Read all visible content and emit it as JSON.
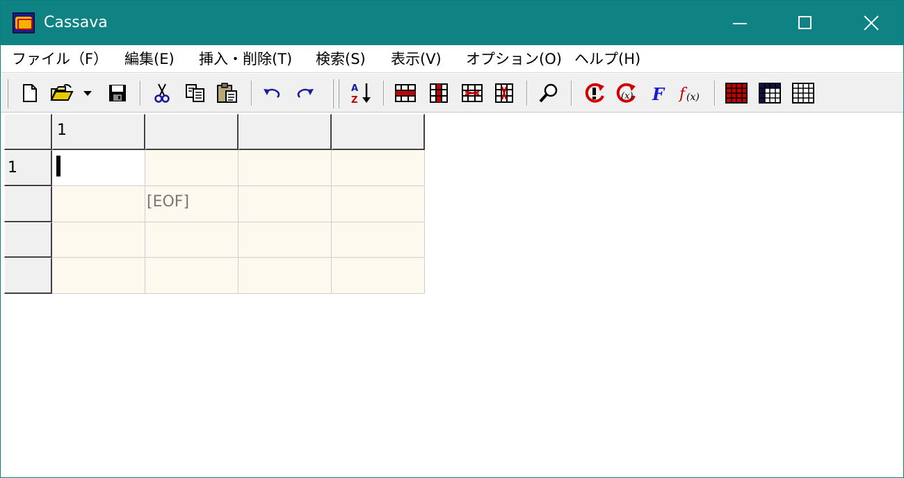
{
  "window": {
    "title": "Cassava",
    "titlebar_color": "#0f8283",
    "controls": [
      "minimize",
      "maximize",
      "close"
    ]
  },
  "menu": {
    "items": [
      {
        "label": "ファイル（F）"
      },
      {
        "label": "編集(E)"
      },
      {
        "label": "挿入・削除(T)"
      },
      {
        "label": "検索(S)"
      },
      {
        "label": "表示(V)"
      },
      {
        "label": "オプション(O)"
      },
      {
        "label": "ヘルプ(H)"
      }
    ]
  },
  "toolbar": {
    "buttons": [
      {
        "name": "new-file-icon"
      },
      {
        "name": "open-folder-icon"
      },
      {
        "name": "dropdown-arrow-icon"
      },
      {
        "name": "save-icon"
      },
      {
        "name": "cut-icon"
      },
      {
        "name": "copy-icon"
      },
      {
        "name": "paste-icon"
      },
      {
        "name": "undo-icon"
      },
      {
        "name": "redo-icon"
      },
      {
        "name": "sort-az-icon"
      },
      {
        "name": "insert-row-icon"
      },
      {
        "name": "insert-column-icon"
      },
      {
        "name": "delete-row-icon"
      },
      {
        "name": "delete-column-icon"
      },
      {
        "name": "find-icon"
      },
      {
        "name": "recalc-icon"
      },
      {
        "name": "recalc-all-icon"
      },
      {
        "name": "formula-icon"
      },
      {
        "name": "function-icon"
      },
      {
        "name": "grid-red-icon"
      },
      {
        "name": "grid-dark-icon"
      },
      {
        "name": "grid-light-icon"
      }
    ]
  },
  "grid": {
    "column_headers": [
      "1",
      "",
      "",
      ""
    ],
    "row_headers": [
      "1",
      "",
      "",
      ""
    ],
    "eof_label": "[EOF]",
    "cell_bg": "#fdf9ee",
    "active_cell_bg": "#ffffff"
  }
}
